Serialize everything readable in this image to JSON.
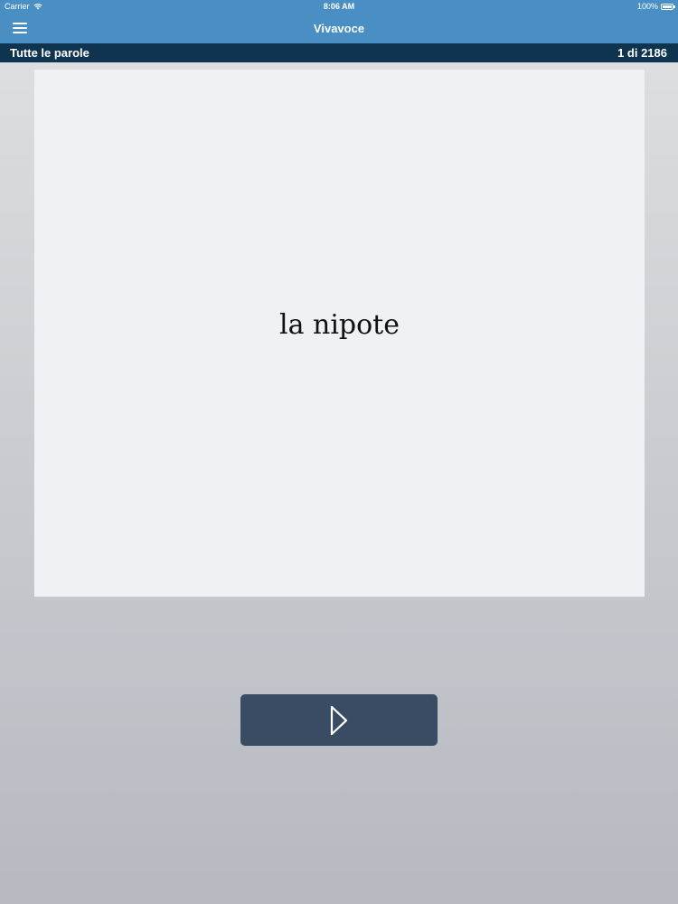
{
  "status_bar": {
    "carrier": "Carrier",
    "time": "8:06 AM",
    "battery_percent": "100%"
  },
  "nav": {
    "title": "Vivavoce",
    "menu_icon": "hamburger-menu-icon"
  },
  "sub_header": {
    "deck_name": "Tutte le parole",
    "counter": "1 di 2186"
  },
  "card": {
    "word": "la nipote"
  },
  "controls": {
    "play_icon": "play-icon"
  },
  "colors": {
    "nav_blue": "#4a8fc4",
    "sub_header_navy": "#0f3450",
    "button_slate": "#3a4c63",
    "card_background": "#eff1f4"
  }
}
